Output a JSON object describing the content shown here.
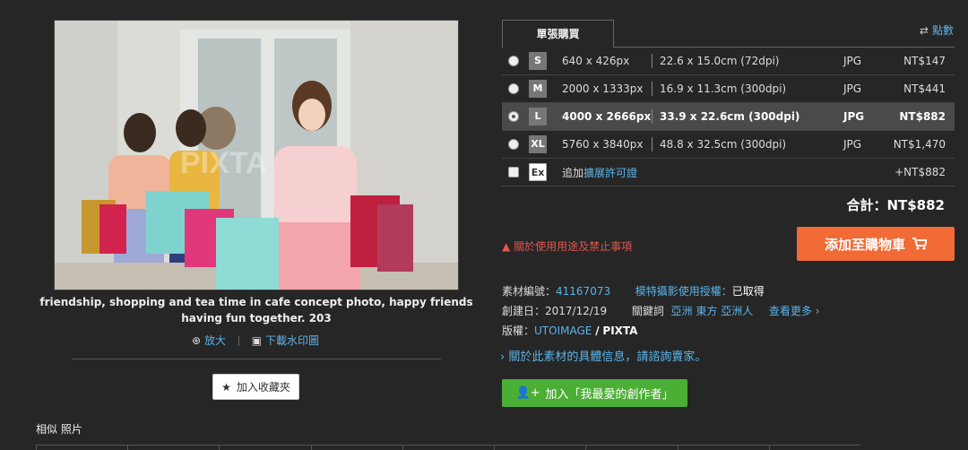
{
  "photo": {
    "alt": "friendship, shopping and tea time in cafe concept photo, happy friends having fun together. 203",
    "watermark": "PIXTA",
    "caption": "friendship, shopping and tea time in cafe concept photo, happy friends having fun together. 203"
  },
  "actions": {
    "zoom_label": "放大",
    "download_label": "下載水印圖"
  },
  "favorite_label": "加入收藏夾",
  "similar_label": "相似 照片",
  "purchase": {
    "tab_label": "單張購買",
    "compare_label": "點數",
    "rows": [
      {
        "size": "S",
        "pixels": "640 x 426px",
        "cm": "22.6 x 15.0cm (72dpi)",
        "format": "JPG",
        "price": "NT$147",
        "selected": false
      },
      {
        "size": "M",
        "pixels": "2000 x 1333px",
        "cm": "16.9 x 11.3cm (300dpi)",
        "format": "JPG",
        "price": "NT$441",
        "selected": false
      },
      {
        "size": "L",
        "pixels": "4000 x 2666px",
        "cm": "33.9 x 22.6cm (300dpi)",
        "format": "JPG",
        "price": "NT$882",
        "selected": true
      },
      {
        "size": "XL",
        "pixels": "5760 x 3840px",
        "cm": "48.8 x 32.5cm (300dpi)",
        "format": "JPG",
        "price": "NT$1,470",
        "selected": false
      }
    ],
    "extended": {
      "badge": "Ex",
      "prefix": "追加",
      "link": "擴展許可證",
      "price": "+NT$882"
    },
    "total_label": "合計：",
    "total_value": "NT$882",
    "warning": "關於使用用途及禁止事項",
    "cart_label": "添加至購物車"
  },
  "meta": {
    "id_label": "素材編號：",
    "id_value": "41167073",
    "release_label": "模特攝影使用授權：",
    "release_value": "已取得",
    "date_label": "創建日：",
    "date_value": "2017/12/19",
    "keywords_label": "關鍵詞",
    "keywords": [
      "亞洲",
      "東方",
      "亞洲人"
    ],
    "more_label": "查看更多",
    "copyright_label": "版權：",
    "copyright_owner": "UTOIMAGE",
    "copyright_sep": "/",
    "copyright_agency": "PIXTA"
  },
  "inquire_label": "關於此素材的具體信息，請諮詢賣家。",
  "creator_label": "加入「我最愛的創作者」",
  "colors": {
    "accent_link": "#5ab4e8",
    "cart": "#f26a35",
    "creator": "#4caf35",
    "warning": "#e0574f"
  }
}
